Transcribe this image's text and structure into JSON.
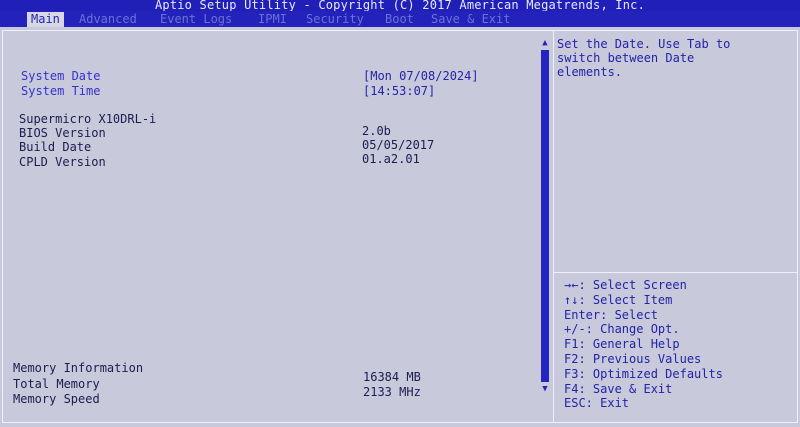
{
  "title_bar": "Aptio Setup Utility - Copyright (C) 2017 American Megatrends, Inc.",
  "tabs": [
    {
      "label": "Main",
      "active": true
    },
    {
      "label": "Advanced",
      "active": false
    },
    {
      "label": "Event Logs",
      "active": false
    },
    {
      "label": "IPMI",
      "active": false
    },
    {
      "label": "Security",
      "active": false
    },
    {
      "label": "Boot",
      "active": false
    },
    {
      "label": "Save & Exit",
      "active": false
    }
  ],
  "settings": {
    "system_date": {
      "label": "System Date",
      "value": "[Mon 07/08/2024]"
    },
    "system_time": {
      "label": "System Time",
      "value": "[14:53:07]"
    }
  },
  "info": {
    "product": {
      "label": "Supermicro X10DRL-i"
    },
    "bios_version": {
      "label": "BIOS Version",
      "value": "2.0b"
    },
    "build_date": {
      "label": "Build Date",
      "value": "05/05/2017"
    },
    "cpld_version": {
      "label": "CPLD Version",
      "value": "01.a2.01"
    }
  },
  "memory": {
    "heading": "Memory Information",
    "total": {
      "label": "Total Memory",
      "value": "16384 MB"
    },
    "speed": {
      "label": "Memory Speed",
      "value": "2133 MHz"
    }
  },
  "help": {
    "lines": [
      "Set the Date. Use Tab to",
      "switch between Date",
      "elements."
    ]
  },
  "keys": [
    "→←: Select Screen",
    "↑↓: Select Item",
    "Enter: Select",
    "+/-: Change Opt.",
    "F1: General Help",
    "F2: Previous Values",
    "F3: Optimized Defaults",
    "F4: Save & Exit",
    "ESC: Exit"
  ],
  "scrollbar": {
    "up_arrow": "▲",
    "down_arrow": "▼"
  },
  "colors": {
    "bar_blue": "#2323bc",
    "background": "#c8c9da",
    "highlight_text": "#3333cc"
  }
}
